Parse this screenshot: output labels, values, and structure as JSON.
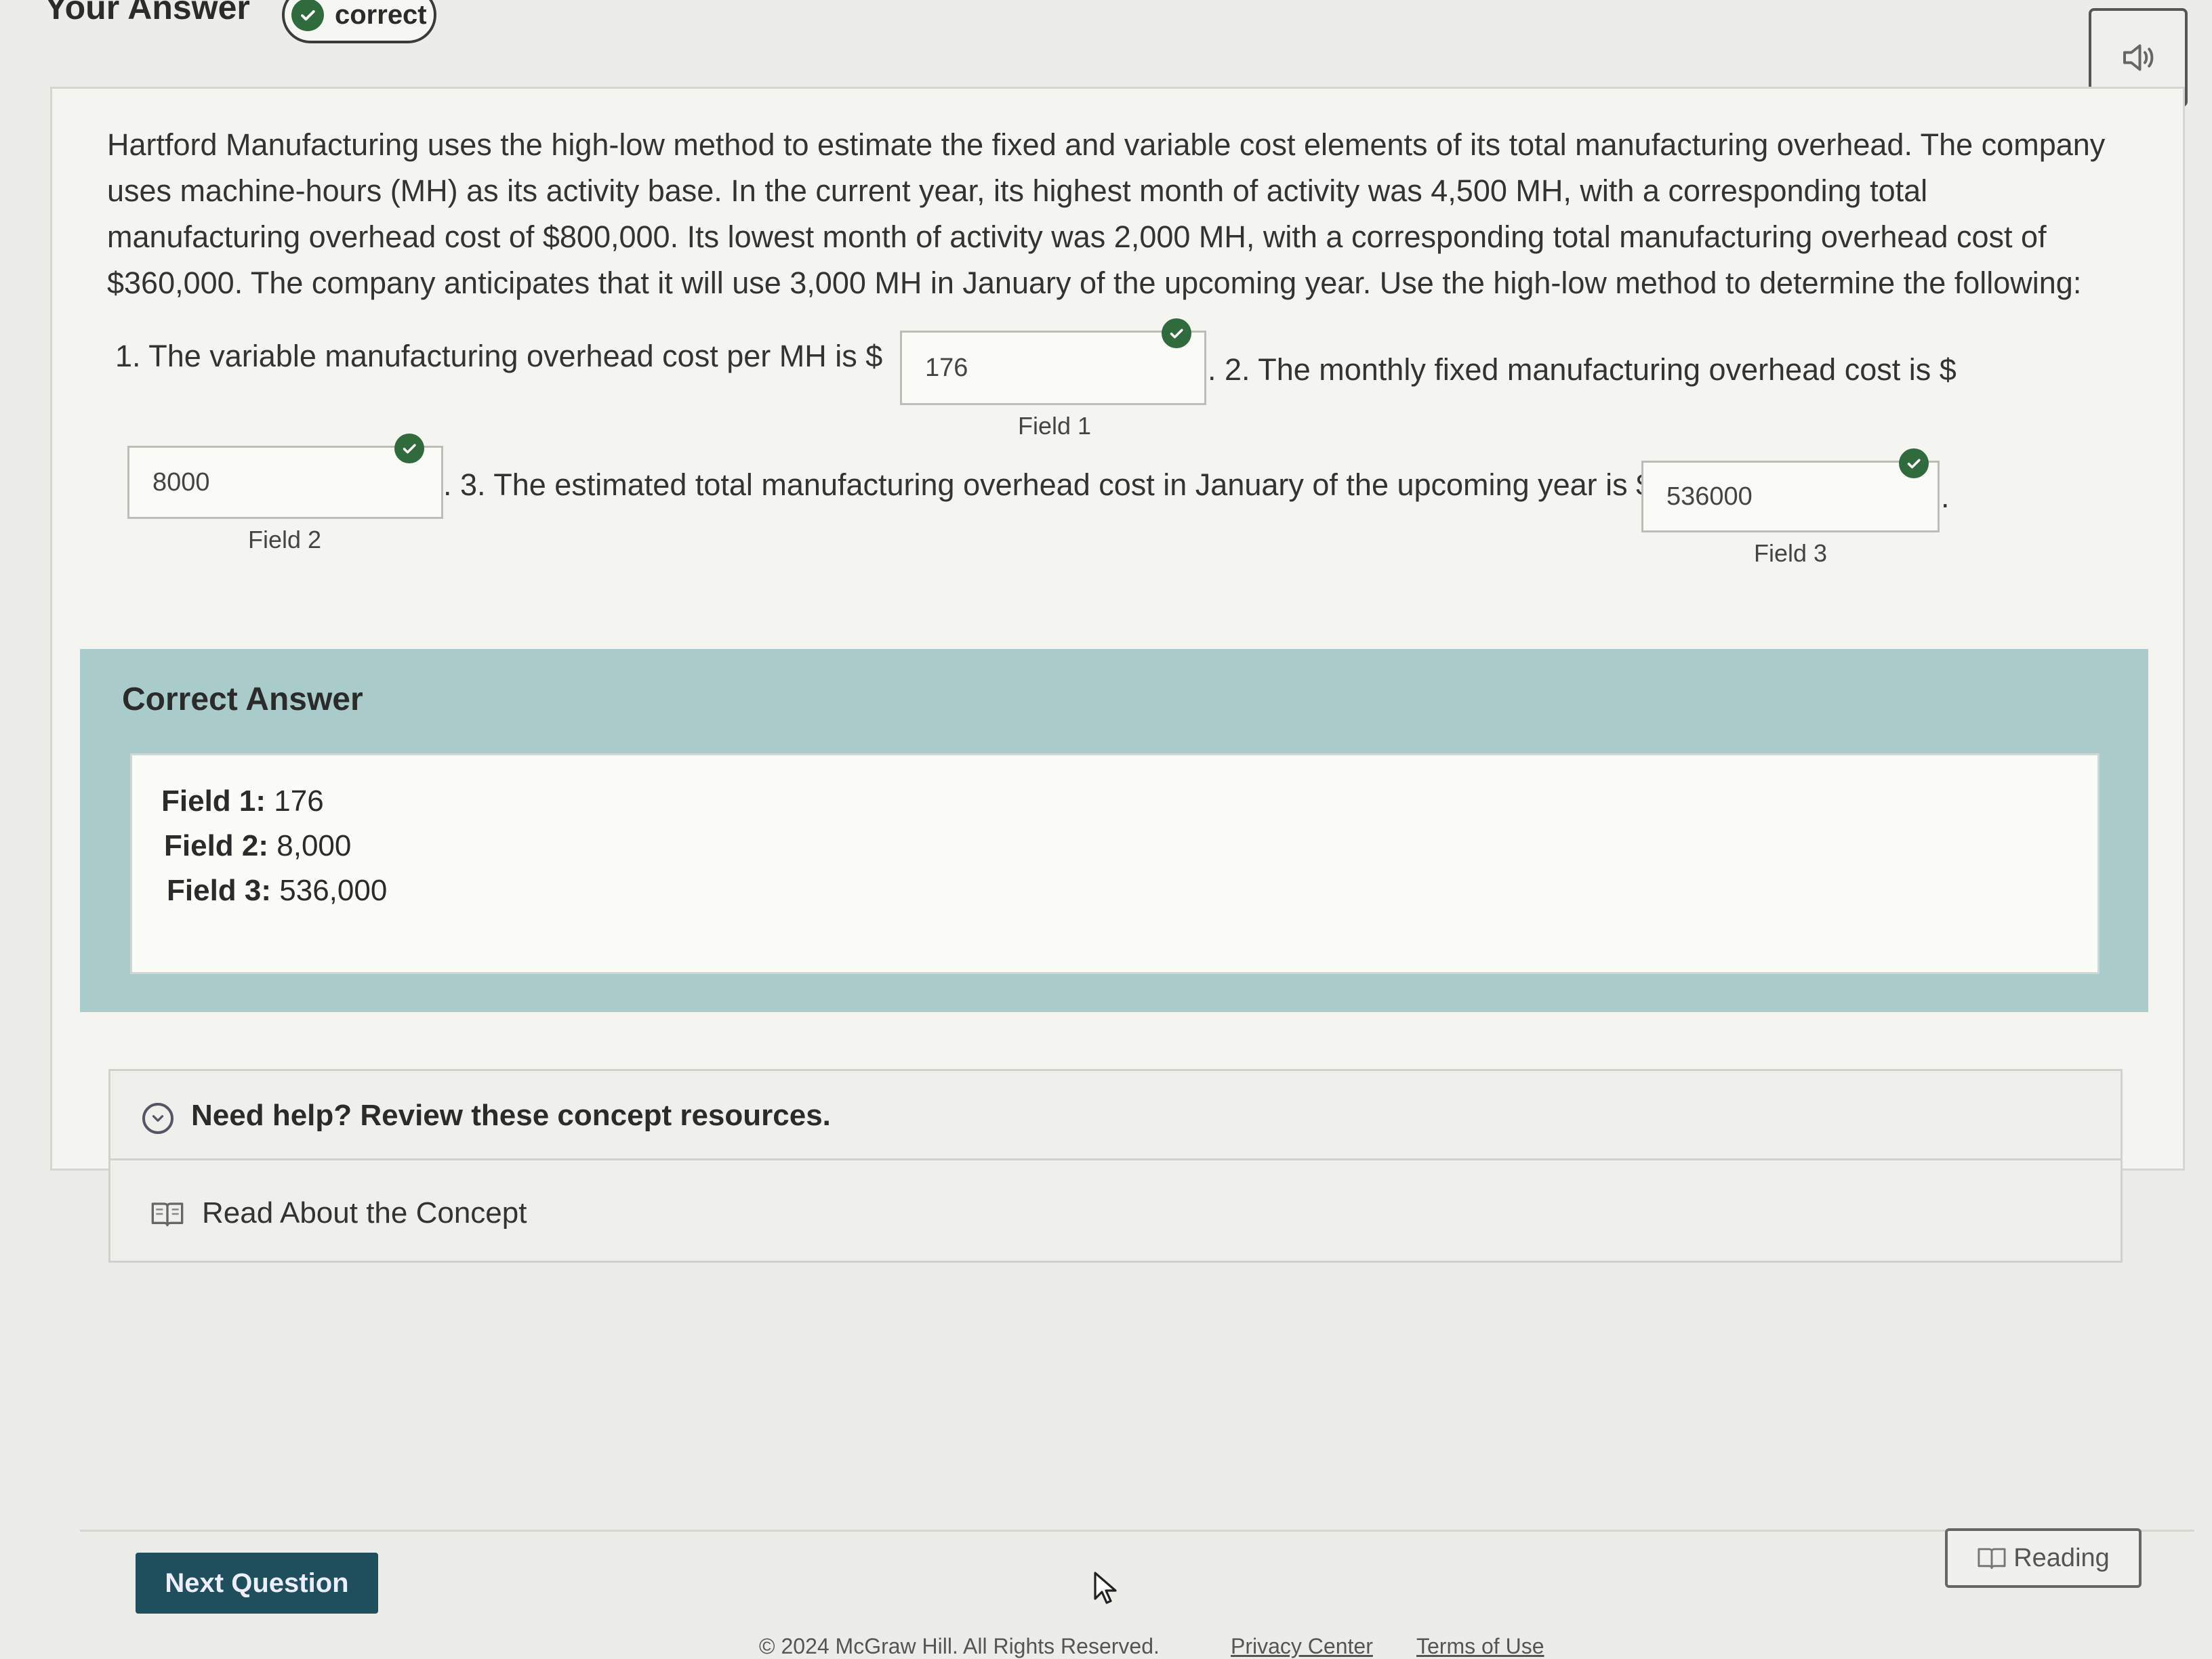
{
  "header": {
    "title": "Your Answer",
    "status_badge": "correct"
  },
  "question": {
    "intro": "Hartford Manufacturing uses the high-low method to estimate the fixed and variable cost elements of its total manufacturing overhead. The company uses machine-hours (MH) as its activity base. In the current year, its highest month of activity was 4,500 MH, with a corresponding total manufacturing overhead cost of $800,000. Its lowest month of activity was 2,000 MH, with a corresponding total manufacturing overhead cost of $360,000. The company anticipates that it will use 3,000 MH in January of the upcoming year. Use the high-low method to determine the following:",
    "part1_prefix": "1. The variable manufacturing overhead cost per MH is $",
    "part2_prefix": ". 2. The monthly fixed manufacturing overhead cost is $",
    "part3_prefix": ". 3. The estimated total manufacturing overhead cost in January of the upcoming year is $",
    "suffix": ".",
    "fields": [
      {
        "label": "Field 1",
        "value": "176"
      },
      {
        "label": "Field 2",
        "value": "8000"
      },
      {
        "label": "Field 3",
        "value": "536000"
      }
    ]
  },
  "correct_answer": {
    "title": "Correct Answer",
    "rows": [
      {
        "label": "Field 1:",
        "value": "176"
      },
      {
        "label": "Field 2:",
        "value": "8,000"
      },
      {
        "label": "Field 3:",
        "value": "536,000"
      }
    ]
  },
  "help": {
    "title": "Need help? Review these concept resources.",
    "link": "Read About the Concept"
  },
  "footer": {
    "next_button": "Next Question",
    "reading_button": "Reading",
    "copyright": "© 2024 McGraw Hill. All Rights Reserved.",
    "privacy": "Privacy Center",
    "terms": "Terms of Use"
  },
  "icons": {
    "check": "check-circle-icon",
    "audio": "speaker-icon",
    "chevron": "chevron-down-circle-icon",
    "book": "book-icon",
    "cursor": "mouse-pointer-icon"
  },
  "colors": {
    "check_green": "#2f6b3c",
    "correct_panel": "#a9cccb",
    "next_button": "#1f4e5c"
  }
}
